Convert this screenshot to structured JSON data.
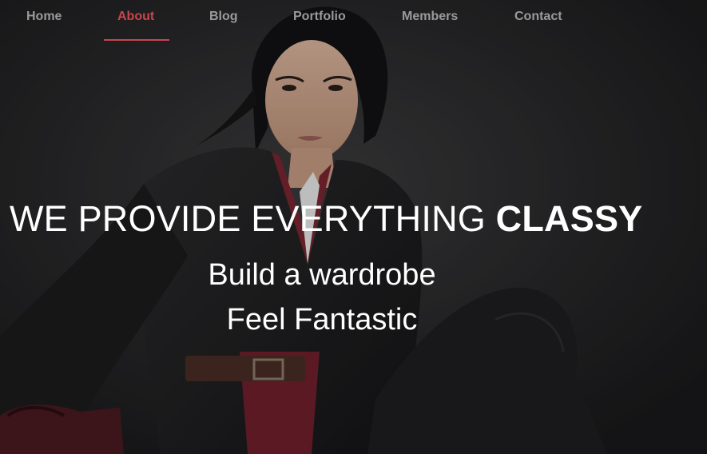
{
  "nav": {
    "items": [
      {
        "label": "Home",
        "active": false
      },
      {
        "label": "About",
        "active": true
      },
      {
        "label": "Blog",
        "active": false
      },
      {
        "label": "Portfolio",
        "active": false
      },
      {
        "label": "Members",
        "active": false
      },
      {
        "label": "Contact",
        "active": false
      }
    ],
    "active_color": "#c8454f",
    "inactive_color": "#9a9a9a"
  },
  "hero": {
    "headline_regular": "WE PROVIDE EVERYTHING ",
    "headline_bold": "CLASSY",
    "subline_1": "Build a wardrobe",
    "subline_2": "Feel Fantastic",
    "text_color": "#ffffff"
  }
}
